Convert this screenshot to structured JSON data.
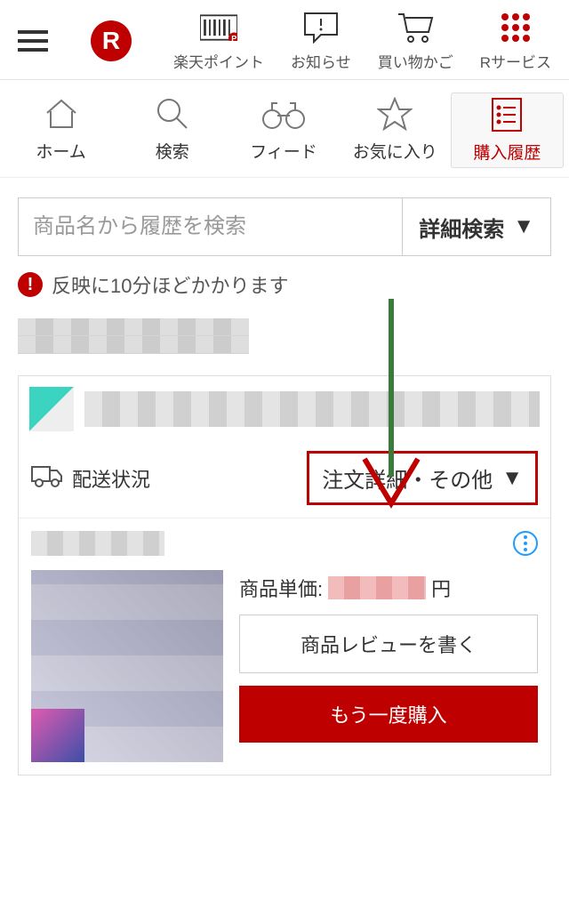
{
  "header": {
    "points_label": "楽天ポイント",
    "notice_label": "お知らせ",
    "cart_label": "買い物かご",
    "services_label": "Rサービス"
  },
  "nav": {
    "home": "ホーム",
    "search": "検索",
    "feed": "フィード",
    "favorite": "お気に入り",
    "history": "購入履歴"
  },
  "search": {
    "placeholder": "商品名から履歴を検索",
    "advanced_label": "詳細検索"
  },
  "alert": {
    "text": "反映に10分ほどかかります"
  },
  "order": {
    "shipping_label": "配送状況",
    "detail_button": "注文詳細・その他",
    "price_label_prefix": "商品単価:",
    "price_suffix": "円",
    "review_button": "商品レビューを書く",
    "rebuy_button": "もう一度購入"
  }
}
